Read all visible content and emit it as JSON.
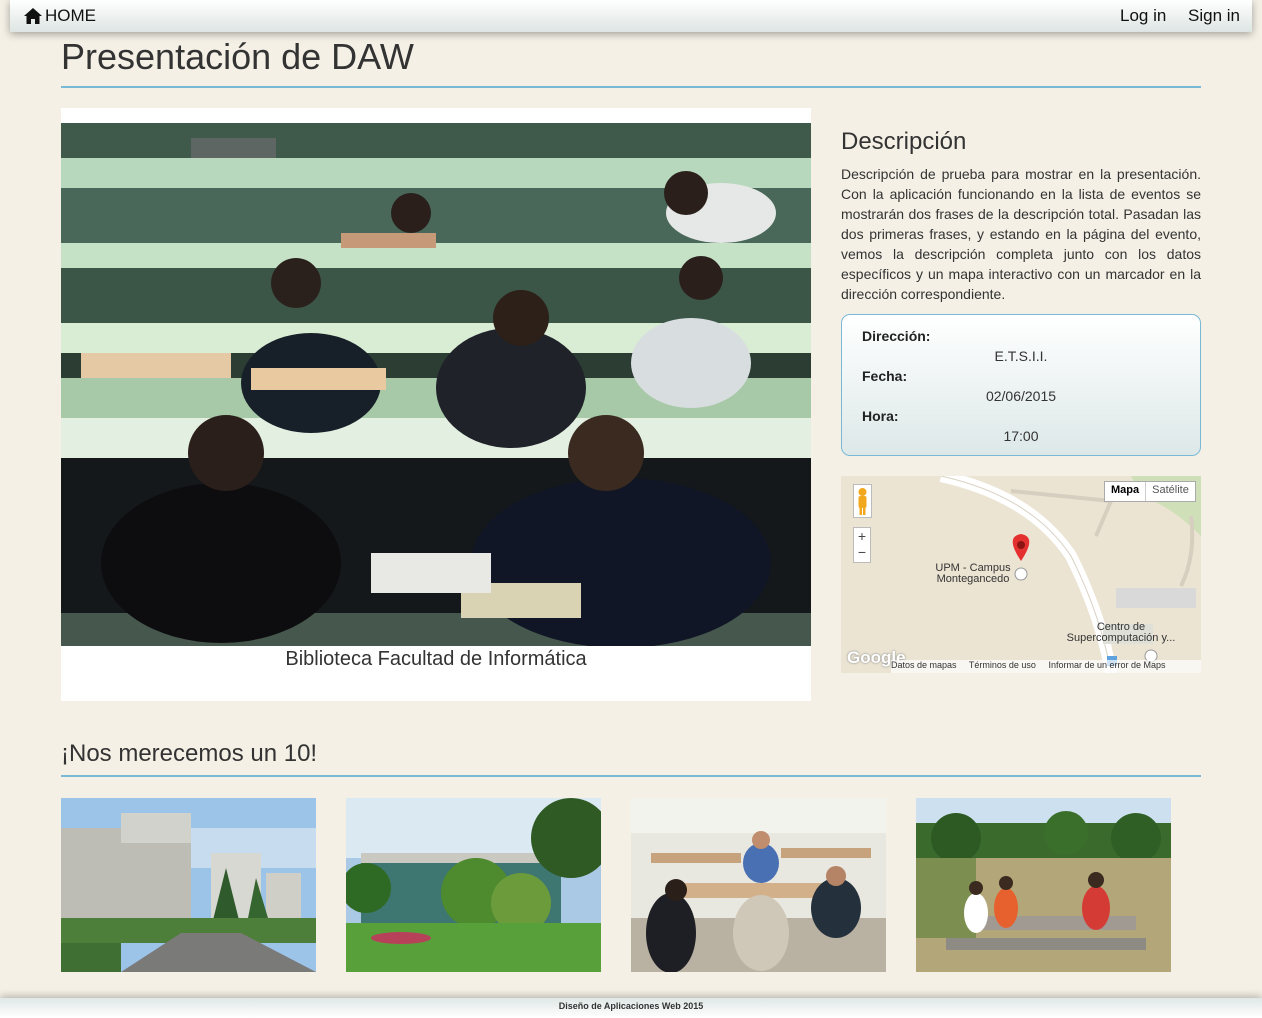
{
  "nav": {
    "home_label": "HOME",
    "login_label": "Log in",
    "signin_label": "Sign in"
  },
  "page_title": "Presentación de DAW",
  "main_image": {
    "caption": "Biblioteca Facultad de Informática"
  },
  "description": {
    "title": "Descripción",
    "text": "Descripción de prueba para mostrar en la presentación. Con la aplicación funcionando en la lista de eventos se mostrarán dos frases de la descripción total. Pasadan las dos primeras frases, y estando en la página del evento, vemos la descripción completa junto con los datos específicos y un mapa interactivo con un marcador en la dirección correspondiente."
  },
  "details": {
    "address_label": "Dirección:",
    "address_value": "E.T.S.I.I.",
    "date_label": "Fecha:",
    "date_value": "02/06/2015",
    "time_label": "Hora:",
    "time_value": "17:00"
  },
  "map": {
    "type_map": "Mapa",
    "type_satellite": "Satélite",
    "zoom_in": "+",
    "zoom_out": "−",
    "marker_label": "UPM - Campus Montegancedo",
    "place_label": "Centro de Supercomputación y...",
    "brand": "Google",
    "footer_links": [
      "Datos de mapas",
      "Términos de uso",
      "Informar de un error de Maps"
    ]
  },
  "gallery": {
    "title": "¡Nos merecemos un 10!"
  },
  "footer": {
    "text": "Diseño de Aplicaciones Web 2015"
  }
}
